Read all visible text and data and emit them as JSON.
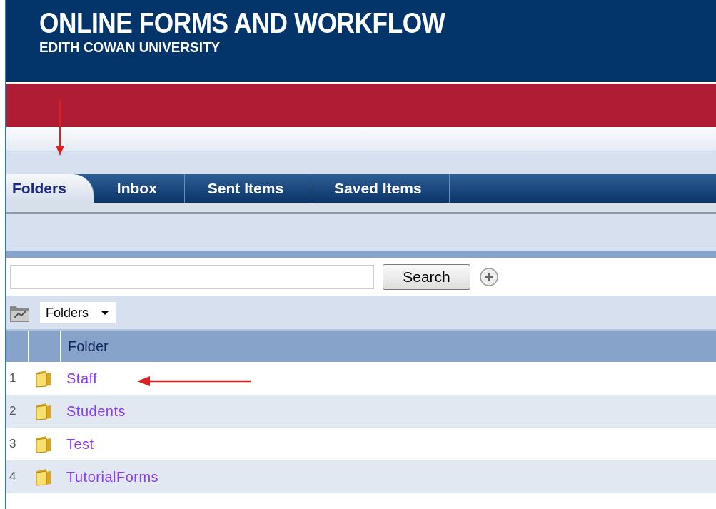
{
  "header": {
    "title": "ONLINE FORMS AND WORKFLOW",
    "subtitle": "EDITH COWAN UNIVERSITY"
  },
  "tabs": [
    {
      "label": "Folders",
      "selected": true
    },
    {
      "label": "Inbox",
      "selected": false
    },
    {
      "label": "Sent Items",
      "selected": false
    },
    {
      "label": "Saved Items",
      "selected": false
    }
  ],
  "search": {
    "button": "Search"
  },
  "view_select": {
    "value": "Folders"
  },
  "table": {
    "columns": [
      "Folder"
    ],
    "rows": [
      {
        "number": "1",
        "name": "Staff"
      },
      {
        "number": "2",
        "name": "Students"
      },
      {
        "number": "3",
        "name": "Test"
      },
      {
        "number": "4",
        "name": "TutorialForms"
      }
    ]
  }
}
